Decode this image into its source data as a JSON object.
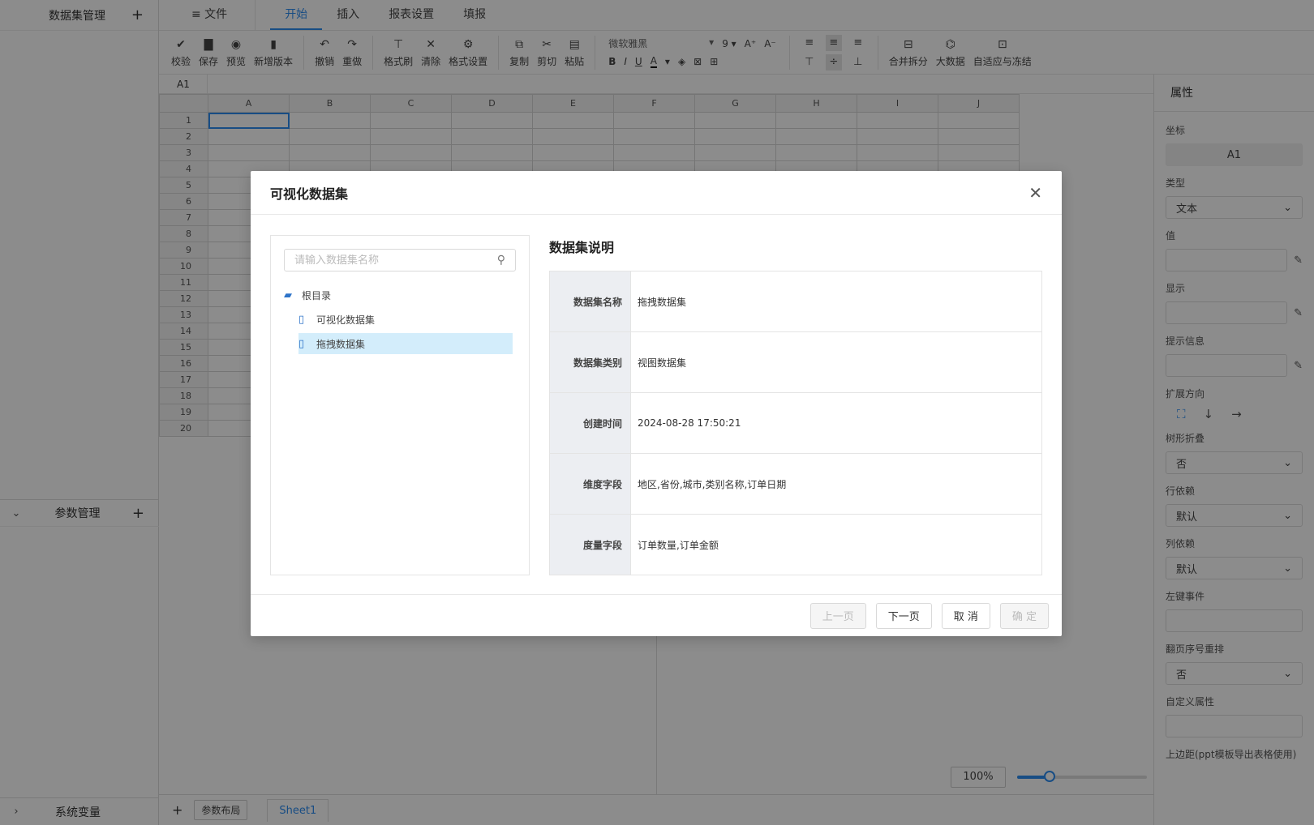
{
  "left_panel": {
    "dataset_title": "数据集管理",
    "params_title": "参数管理",
    "sys_title": "系统变量",
    "plus": "+"
  },
  "menu": {
    "file": "≡ 文件",
    "tabs": [
      "开始",
      "插入",
      "报表设置",
      "填报"
    ]
  },
  "toolbar": {
    "buttons": [
      {
        "icon": "✔",
        "label": "校验"
      },
      {
        "icon": "▇",
        "label": "保存"
      },
      {
        "icon": "◉",
        "label": "预览"
      },
      {
        "icon": "▮",
        "label": "新增版本"
      },
      {
        "icon": "↶",
        "label": "撤销"
      },
      {
        "icon": "↷",
        "label": "重做"
      },
      {
        "icon": "⊤",
        "label": "格式刷"
      },
      {
        "icon": "✕",
        "label": "清除"
      },
      {
        "icon": "⚙",
        "label": "格式设置"
      },
      {
        "icon": "⧉",
        "label": "复制"
      },
      {
        "icon": "✂",
        "label": "剪切"
      },
      {
        "icon": "▤",
        "label": "粘贴"
      },
      {
        "icon": "⊟",
        "label": "合并拆分"
      },
      {
        "icon": "⌬",
        "label": "大数据"
      },
      {
        "icon": "⊡",
        "label": "自适应与冻结"
      }
    ],
    "font_name": "微软雅黑",
    "font_size": "9",
    "grow": "A⁺",
    "shrink": "A⁻",
    "bold": "B",
    "italic": "I",
    "underline": "U",
    "color": "A"
  },
  "formula": {
    "cell_ref": "A1"
  },
  "grid": {
    "columns": [
      "A",
      "B",
      "C",
      "D",
      "E",
      "F",
      "G",
      "H",
      "I",
      "J"
    ],
    "rows": [
      "1",
      "2",
      "3",
      "4",
      "5",
      "6",
      "7",
      "8",
      "9",
      "10",
      "11",
      "12",
      "13",
      "14",
      "15",
      "16",
      "17",
      "18",
      "19",
      "20"
    ]
  },
  "props": {
    "title": "属性",
    "coord_label": "坐标",
    "coord_value": "A1",
    "type_label": "类型",
    "type_value": "文本",
    "value_label": "值",
    "display_label": "显示",
    "tip_label": "提示信息",
    "expand_label": "扩展方向",
    "tree_label": "树形折叠",
    "tree_value": "否",
    "row_dep_label": "行依赖",
    "row_dep_value": "默认",
    "col_dep_label": "列依赖",
    "col_dep_value": "默认",
    "click_label": "左键事件",
    "page_label": "翻页序号重排",
    "page_value": "否",
    "custom_label": "自定义属性",
    "margin_label": "上边距(ppt模板导出表格使用)"
  },
  "bottom": {
    "add": "+",
    "param_layout": "参数布局",
    "sheet": "Sheet1",
    "zoom": "100%",
    "zoom_level": 0.25
  },
  "modal": {
    "title": "可视化数据集",
    "close": "✕",
    "search_placeholder": "请输入数据集名称",
    "tree_root": "根目录",
    "tree_items": [
      "可视化数据集",
      "拖拽数据集"
    ],
    "desc_title": "数据集说明",
    "desc_rows": [
      {
        "key": "数据集名称",
        "value": "拖拽数据集"
      },
      {
        "key": "数据集类别",
        "value": "视图数据集"
      },
      {
        "key": "创建时间",
        "value": "2024-08-28 17:50:21"
      },
      {
        "key": "维度字段",
        "value": "地区,省份,城市,类别名称,订单日期"
      },
      {
        "key": "度量字段",
        "value": "订单数量,订单金额"
      }
    ],
    "buttons": {
      "prev": "上一页",
      "next": "下一页",
      "cancel": "取 消",
      "ok": "确 定"
    }
  }
}
